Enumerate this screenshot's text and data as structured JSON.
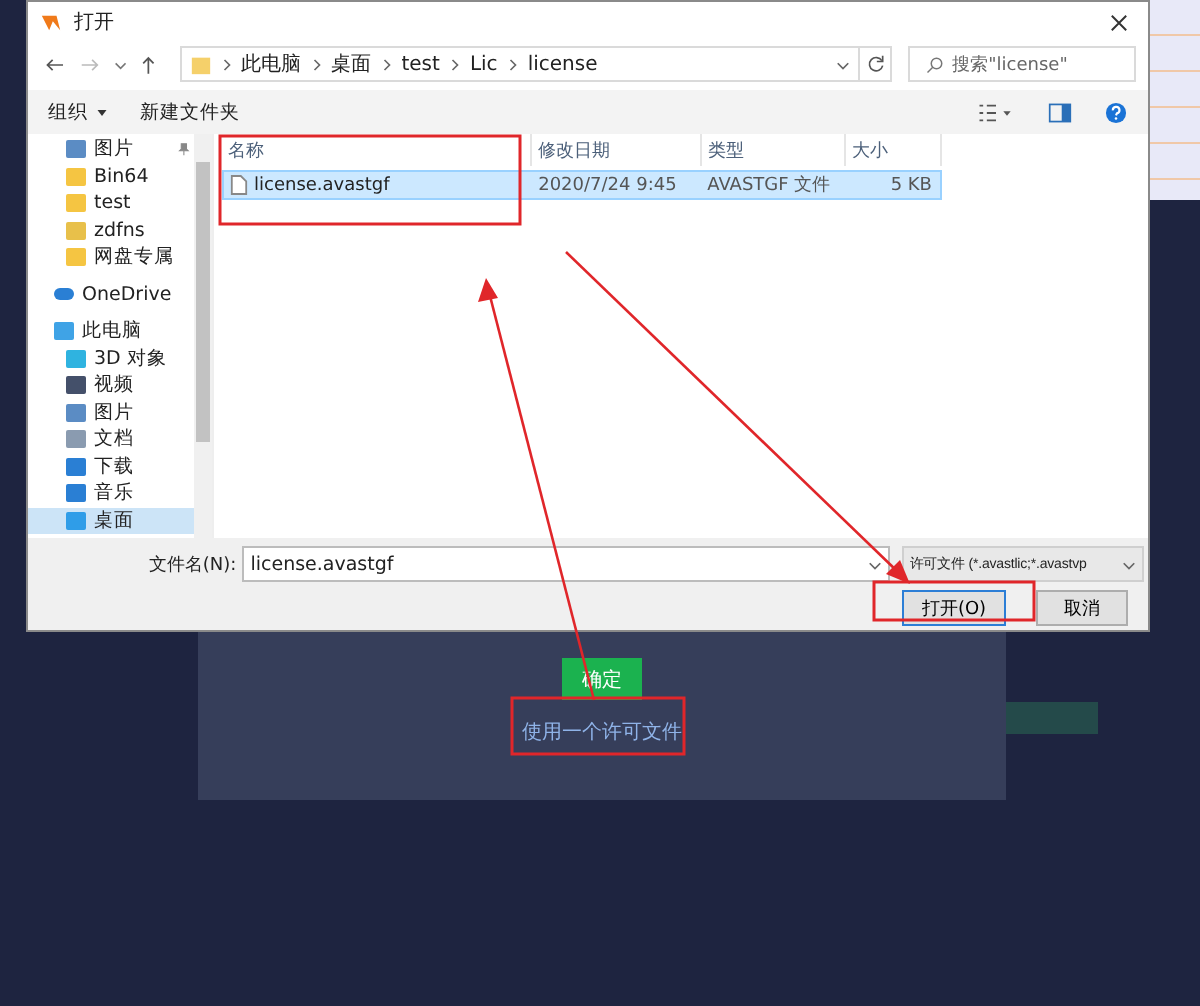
{
  "window": {
    "title": "打开"
  },
  "address": {
    "path": [
      "此电脑",
      "桌面",
      "test",
      "Lic",
      "license"
    ]
  },
  "search": {
    "placeholder": "搜索\"license\""
  },
  "toolbar": {
    "items": [
      {
        "label": "组织",
        "dropdown": true
      },
      {
        "label": "新建文件夹",
        "dropdown": false
      }
    ]
  },
  "sidebar": {
    "items": [
      {
        "label": "图片",
        "kind": "pictures",
        "selected": false,
        "pinned": true
      },
      {
        "label": "Bin64",
        "kind": "folder",
        "selected": false,
        "pinned": false
      },
      {
        "label": "test",
        "kind": "folder",
        "selected": false,
        "pinned": false
      },
      {
        "label": "zdfns",
        "kind": "folder-green",
        "selected": false,
        "pinned": false
      },
      {
        "label": "网盘专属",
        "kind": "folder",
        "selected": false,
        "pinned": false
      },
      {
        "label": "OneDrive",
        "kind": "cloud",
        "selected": false,
        "pinned": false
      },
      {
        "label": "此电脑",
        "kind": "pc",
        "selected": false,
        "pinned": false,
        "children": [
          {
            "label": "3D 对象",
            "kind": "cube",
            "selected": false,
            "pinned": false
          },
          {
            "label": "视频",
            "kind": "video",
            "selected": false,
            "pinned": false
          },
          {
            "label": "图片",
            "kind": "pictures",
            "selected": false,
            "pinned": false
          },
          {
            "label": "文档",
            "kind": "document",
            "selected": false,
            "pinned": false
          },
          {
            "label": "下载",
            "kind": "download",
            "selected": false,
            "pinned": false
          },
          {
            "label": "音乐",
            "kind": "music",
            "selected": false,
            "pinned": false
          },
          {
            "label": "桌面",
            "kind": "desktop",
            "selected": true,
            "pinned": false
          }
        ]
      }
    ]
  },
  "table": {
    "columns": [
      "名称",
      "修改日期",
      "类型",
      "大小"
    ],
    "rows": [
      {
        "cells": [
          "license.avastgf",
          "2020/7/24 9:45",
          "AVASTGF 文件",
          "5 KB"
        ],
        "selected": true
      }
    ]
  },
  "filename": {
    "label": "文件名(N):",
    "value": "license.avastgf"
  },
  "filter": {
    "value": "许可文件 (*.avastlic;*.avastvp"
  },
  "buttons": [
    {
      "label": "打开(O)",
      "kind": "primary"
    },
    {
      "label": "取消",
      "kind": "normal"
    }
  ],
  "background_app": {
    "confirm_button": "确定",
    "link": "使用一个许可文件"
  }
}
